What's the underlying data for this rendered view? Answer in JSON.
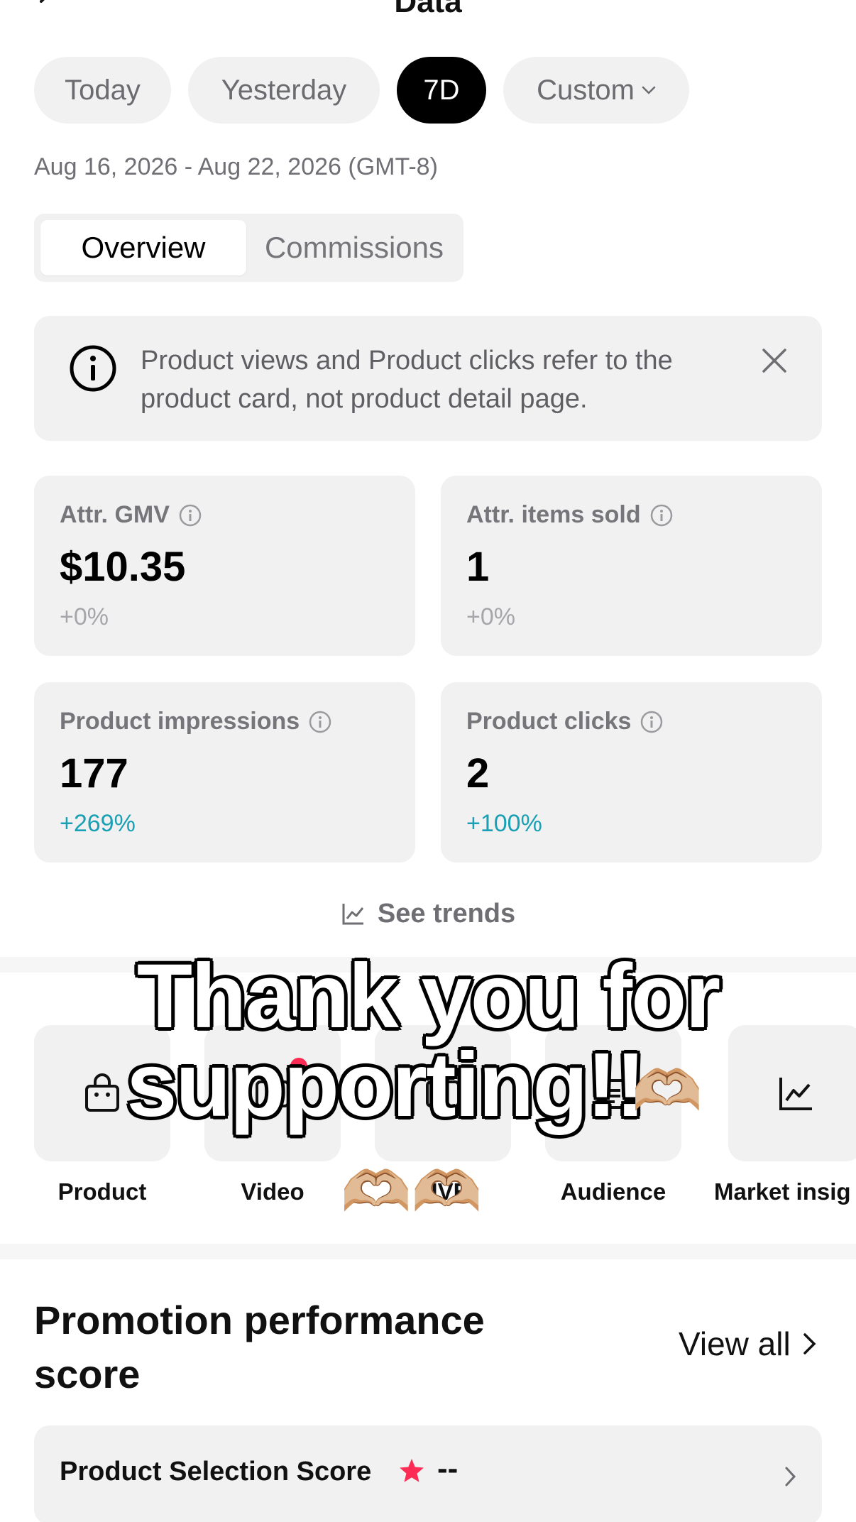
{
  "header": {
    "title": "Data"
  },
  "range": {
    "chips": [
      "Today",
      "Yesterday",
      "7D",
      "Custom"
    ],
    "selected": "7D",
    "date_text": "Aug 16, 2026 - Aug 22, 2026 (GMT-8)"
  },
  "tabs": {
    "overview": "Overview",
    "commissions": "Commissions",
    "selected": "Overview"
  },
  "banner": {
    "text": "Product views and Product clicks refer to the product card, not product detail page."
  },
  "metrics": [
    {
      "label": "Attr. GMV",
      "value": "$10.35",
      "delta": "+0%"
    },
    {
      "label": "Attr. items sold",
      "value": "1",
      "delta": "+0%"
    },
    {
      "label": "Product impressions",
      "value": "177",
      "delta": "+269%"
    },
    {
      "label": "Product clicks",
      "value": "2",
      "delta": "+100%"
    }
  ],
  "trends": {
    "label": "See trends"
  },
  "tools": [
    {
      "label": "Product",
      "icon": "shopping-bag-icon"
    },
    {
      "label": "Video",
      "icon": "video-icon"
    },
    {
      "label": "LIVE",
      "icon": "live-icon"
    },
    {
      "label": "Audience",
      "icon": "audience-icon"
    },
    {
      "label": "Market insig",
      "icon": "line-chart-icon"
    }
  ],
  "promotion": {
    "title": "Promotion performance score",
    "view_all": "View all",
    "score_label": "Product Selection Score",
    "score_value": "--"
  },
  "overlay": {
    "line1": "Thank you for",
    "line2": "supporting!!",
    "hearts1": "🫶🏼",
    "hearts2": "🫶🏼🫶🏼"
  },
  "colors": {
    "positive": "#1aa0b4",
    "accent_red": "#fe2c55",
    "chip_active": "#000000"
  }
}
